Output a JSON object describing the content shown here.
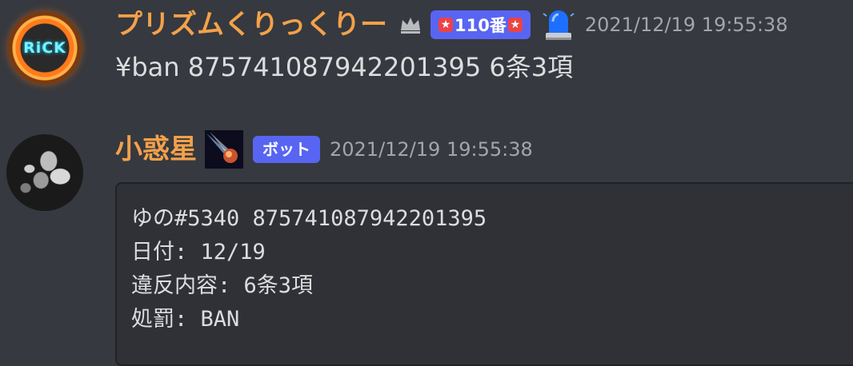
{
  "messages": [
    {
      "username": "プリズムくりっくりー",
      "avatar_text": "RiCK",
      "role_badge": "110番",
      "role_badge_stars": [
        "★",
        "★"
      ],
      "timestamp": "2021/12/19 19:55:38",
      "content": "¥ban 875741087942201395 6条3項",
      "icons": [
        "crown-icon",
        "siren-icon"
      ]
    },
    {
      "username": "小惑星",
      "bot_badge": "ボット",
      "timestamp": "2021/12/19 19:55:38",
      "code_lines": [
        "ゆの#5340 875741087942201395",
        "日付: 12/19",
        "違反内容: 6条3項",
        "処罰: BAN"
      ],
      "icons": [
        "comet-icon"
      ]
    }
  ],
  "colors": {
    "background": "#36393f",
    "username": "#f4a14a",
    "badge": "#5865f2",
    "timestamp": "#a3a6aa",
    "codeblock": "#2f3136"
  }
}
